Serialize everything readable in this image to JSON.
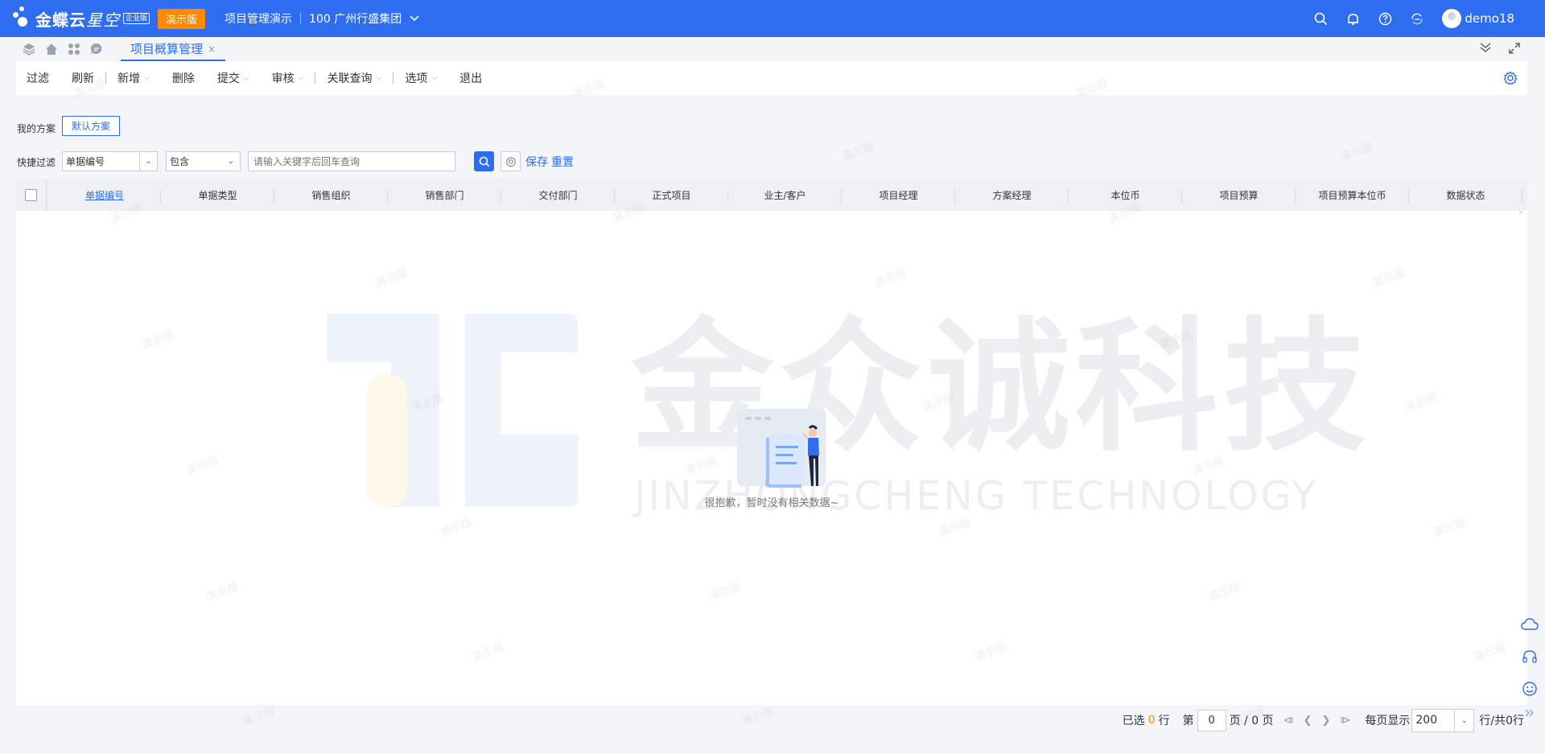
{
  "header": {
    "logo_main": "金蝶云",
    "logo_sub": "星空",
    "edition_badge": "企业版",
    "demo_badge": "演示版",
    "project_title": "项目管理演示",
    "org": "100 广州行盛集团",
    "user": "demo18"
  },
  "tabs": {
    "active_label": "项目概算管理",
    "close_glyph": "×"
  },
  "toolbar": {
    "items": [
      "过滤",
      "刷新",
      "新增",
      "删除",
      "提交",
      "审核",
      "关联查询",
      "选项",
      "退出"
    ]
  },
  "filter": {
    "scheme_label": "我的方案",
    "scheme_button": "默认方案",
    "quick_label": "快捷过滤",
    "field_value": "单据编号",
    "operator_value": "包含",
    "search_placeholder": "请输入关键字后回车查询",
    "save_label": "保存",
    "reset_label": "重置"
  },
  "table": {
    "columns": [
      "单据编号",
      "单据类型",
      "销售组织",
      "销售部门",
      "交付部门",
      "正式项目",
      "业主/客户",
      "项目经理",
      "方案经理",
      "本位币",
      "项目预算",
      "项目预算本位币",
      "数据状态"
    ],
    "empty_text": "很抱歉，暂时没有相关数据~"
  },
  "watermark": {
    "brand_cn": "金众诚科技",
    "brand_en": "JINZHONGCHENG TECHNOLOGY",
    "demo_text": "演示版"
  },
  "pager": {
    "selected_prefix": "已选",
    "selected_count": "0",
    "selected_suffix": "行",
    "page_prefix": "第",
    "page_value": "0",
    "page_suffix": "页 / 0 页",
    "per_page_label": "每页显示",
    "per_page_value": "200",
    "total_text": "行/共0行"
  },
  "colors": {
    "brand_blue": "#2f6df0",
    "accent_orange": "#ff8a00"
  }
}
